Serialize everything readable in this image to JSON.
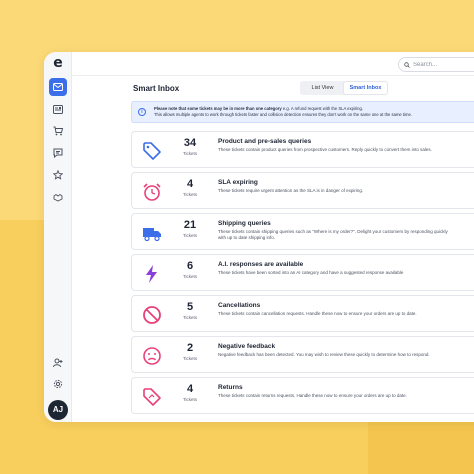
{
  "app": {
    "logo_letter": "e"
  },
  "search": {
    "placeholder": "Search..."
  },
  "page": {
    "title": "Smart Inbox"
  },
  "view_toggle": {
    "list_label": "List View",
    "smart_label": "Smart Inbox",
    "selected": "Smart Inbox"
  },
  "notice": {
    "bold": "Please note that some tickets may be in more than one category",
    "rest": " e.g. A refund request with the SLA expiring.",
    "line2": "This allows multiple agents to work through tickets faster and collision detection ensures they don't work on the same one at the same time."
  },
  "cards": [
    {
      "count": "34",
      "count_label": "Tickets",
      "title": "Product and pre-sales queries",
      "desc": "These tickets contain product queries from prospective customers. Reply quickly to convert them into sales.",
      "icon": "tag-icon",
      "color": "#3b6ee8"
    },
    {
      "count": "4",
      "count_label": "Tickets",
      "title": "SLA expiring",
      "desc": "These tickets require urgent attention as the SLA is in danger of expiring.",
      "icon": "alarm-clock-icon",
      "color": "#e8417a"
    },
    {
      "count": "21",
      "count_label": "Tickets",
      "title": "Shipping queries",
      "desc": "These tickets contain shipping queries such as \"Where is my order?\". Delight your customers by responding quickly with up to date shipping info.",
      "icon": "truck-icon",
      "color": "#3b6ee8"
    },
    {
      "count": "6",
      "count_label": "Tickets",
      "title": "A.I. responses are available",
      "desc": "These tickets have been sorted into an AI category and have a suggested response available",
      "icon": "lightning-icon",
      "color": "#8a3fd9"
    },
    {
      "count": "5",
      "count_label": "Tickets",
      "title": "Cancellations",
      "desc": "These tickets contain cancellation requests. Handle these now to ensure your orders are up to date.",
      "icon": "cancel-icon",
      "color": "#e8417a"
    },
    {
      "count": "2",
      "count_label": "Tickets",
      "title": "Negative feedback",
      "desc": "Negative feedback has been detected. You may wish to review these quickly to determine how to respond.",
      "icon": "sad-face-icon",
      "color": "#e8417a"
    },
    {
      "count": "4",
      "count_label": "Tickets",
      "title": "Returns",
      "desc": "These tickets contain returns requests. Handle these now to ensure your orders are up to date.",
      "icon": "return-tag-icon",
      "color": "#e8417a"
    }
  ],
  "sidebar": {
    "items": [
      "inbox-icon",
      "newspaper-icon",
      "cart-icon",
      "chat-icon",
      "star-icon",
      "handshake-icon"
    ],
    "bottom": [
      "add-user-icon",
      "settings-icon"
    ],
    "avatar_initials": "AJ"
  }
}
